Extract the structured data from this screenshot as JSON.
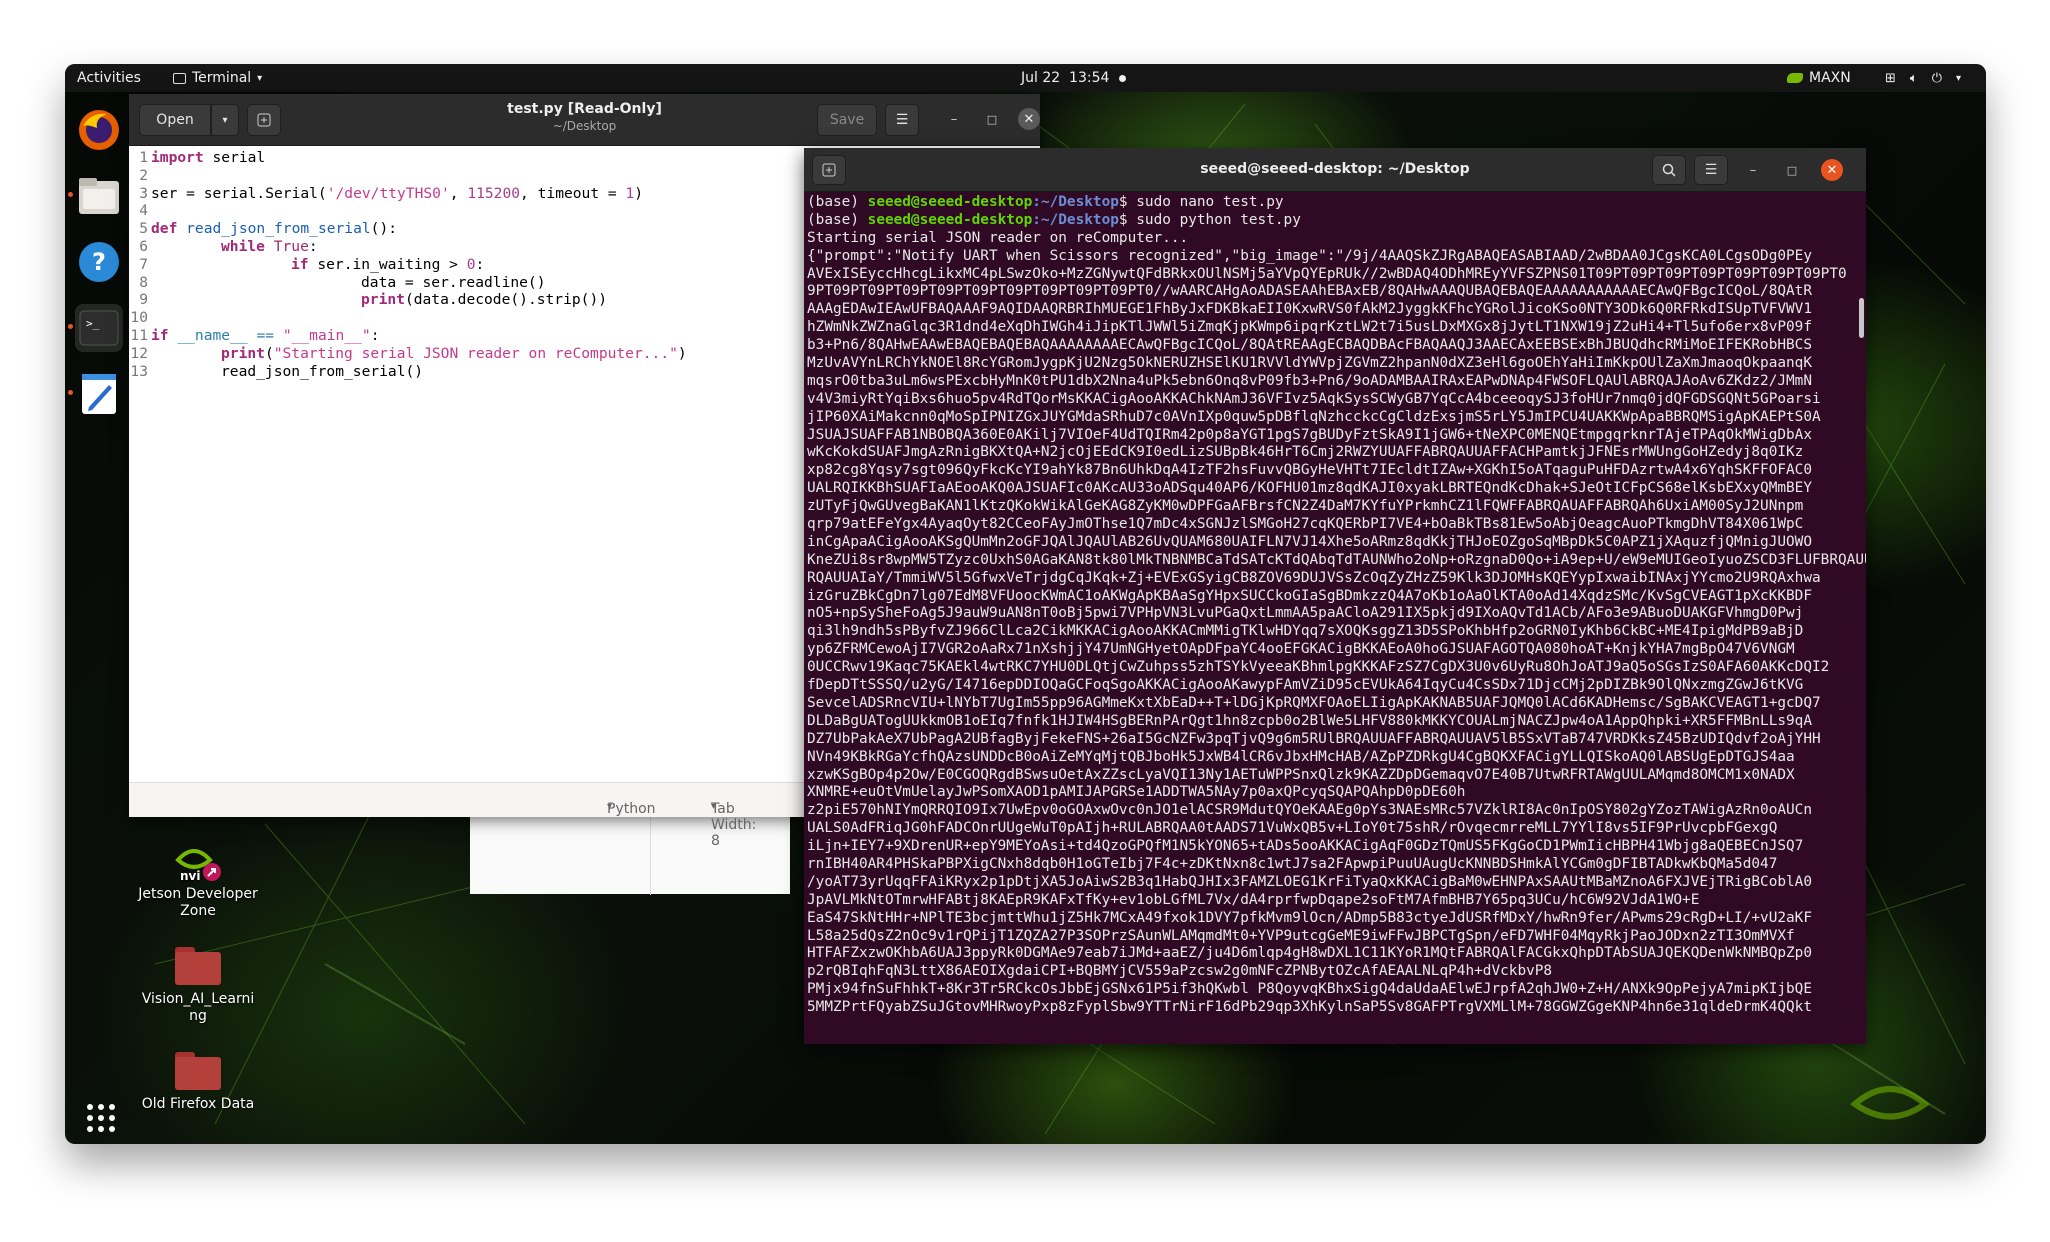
{
  "topbar": {
    "activities": "Activities",
    "app_name": "Terminal",
    "clock": "Jul 22  13:54",
    "power_mode": "MAXN"
  },
  "desktop": {
    "icons": [
      {
        "label": "Jetson Developer Zone"
      },
      {
        "label": "Vision_AI_Learning"
      },
      {
        "label": "Old Firefox Data"
      }
    ]
  },
  "editor": {
    "title": "test.py [Read-Only]",
    "subtitle": "~/Desktop",
    "open_label": "Open",
    "save_label": "Save",
    "status_language": "Python",
    "status_tab": "Tab Width: 8",
    "lines": [
      "1",
      "2",
      "3",
      "4",
      "5",
      "6",
      "7",
      "8",
      "9",
      "10",
      "11",
      "12",
      "13"
    ],
    "code": {
      "l1_kw": "import",
      "l1_rest": " serial",
      "l3_a": "ser = serial.Serial(",
      "l3_str": "'/dev/ttyTHS0'",
      "l3_b": ", ",
      "l3_num": "115200",
      "l3_c": ", timeout = ",
      "l3_num2": "1",
      "l3_d": ")",
      "l5_kw": "def",
      "l5_fn": " read_json_from_serial",
      "l5_rest": "():",
      "l6_kw": "while",
      "l6_val": " True",
      "l6_rest": ":",
      "l7_kw": "if",
      "l7_rest": " ser.in_waiting > ",
      "l7_num": "0",
      "l7_end": ":",
      "l8": "data = ser.readline()",
      "l9_fn": "print",
      "l9_rest": "(data.decode().strip())",
      "l11_kw": "if",
      "l11_a": " __name__ == ",
      "l11_str": "\"__main__\"",
      "l11_b": ":",
      "l12_fn": "print",
      "l12_a": "(",
      "l12_str": "\"Starting serial JSON reader on reComputer...\"",
      "l12_b": ")",
      "l13": "read_json_from_serial()"
    }
  },
  "terminal": {
    "title": "seeed@seeed-desktop: ~/Desktop",
    "prompts": [
      {
        "env": "(base) ",
        "user": "seeed@seeed-desktop",
        "path": ":~/Desktop",
        "cmd": "$ sudo nano test.py"
      },
      {
        "env": "(base) ",
        "user": "seeed@seeed-desktop",
        "path": ":~/Desktop",
        "cmd": "$ sudo python test.py"
      }
    ],
    "output": [
      "Starting serial JSON reader on reComputer...",
      "{\"prompt\":\"Notify UART when Scissors recognized\",\"big_image\":\"/9j/4AAQSkZJRgABAQEASABIAAD/2wBDAA0JCgsKCA0LCgsODg0PEy",
      "AVExISEyccHhcgLikxMC4pLSwzOko+MzZGNywtQFdBRkxOUlNSMj5aYVpQYEpRUk//2wBDAQ4ODhMREyYVFSZPNS01T09PT09PT09PT09PT09PT09PT09PT0",
      "9PT09PT09PT09PT09PT09PT09PT09PT09PT09PT0//wAARCAHgAoADASEAAhEBAxEB/8QAHwAAAQUBAQEBAQEAAAAAAAAAAAECAwQFBgcICQoL/8QAtR",
      "AAAgEDAwIEAwUFBAQAAAF9AQIDAAQRBRIhMUEGE1FhByJxFDKBkaEII0KxwRVS0fAkM2JyggkKFhcYGRolJicoKSo0NTY3ODk6Q0RFRkdISUpTVFVWV1",
      "hZWmNkZWZnaGlqc3R1dnd4eXqDhIWGh4iJipKTlJWWl5iZmqKjpKWmp6ipqrKztLW2t7i5usLDxMXGx8jJytLT1NXW19jZ2uHi4+Tl5ufo6erx8vP09f",
      "b3+Pn6/8QAHwEAAwEBAQEBAQEBAQAAAAAAAAECAwQFBgcICQoL/8QAtREAAgECBAQDBAcFBAQAAQJ3AAECAxEEBSExBhJBUQdhcRMiMoEIFEKRobHBCS",
      "MzUvAVYnLRChYkNOEl8RcYGRomJygpKjU2Nzg5OkNERUZHSElKU1RVVldYWVpjZGVmZ2hpanN0dXZ3eHl6goOEhYaHiImKkpOUlZaXmJmaoqOkpaanqK",
      "mqsrO0tba3uLm6wsPExcbHyMnK0tPU1dbX2Nna4uPk5ebn6Onq8vP09fb3+Pn6/9oADAMBAAIRAxEAPwDNAp4FWSOFLQAUlABRQAJAoAv6ZKdz2/JMmN",
      "v4V3miyRtYqiBxs6huo5pv4RdTQorMsKKACigAooAKKAChkNAmJ36VFIvz5AqkSysSCWyGB7YqCcA4bceeoqySJ3foHUr7nmq0jdQFGDSGQNt5GPoarsi",
      "jIP60XAiMakcnn0qMoSpIPNIZGxJUYGMdaSRhuD7c0AVnIXp0quw5pDBflqNzhcckcCgCldzExsjmS5rLY5JmIPCU4UAKKWpApaBBRQMSigApKAEPtS0A",
      "JSUAJSUAFFAB1NBOBQA360E0AKilj7VIOeF4UdTQIRm42p0p8aYGT1pgS7gBUDyFztSkA9I1jGW6+tNeXPC0MENQEtmpgqrknrTAjeTPAqOkMWigDbAx",
      "wKcKokdSUAFJmgAzRnigBKXtQA+N2jcOjEEdCK9I0edLizSUBpBk46HrT6Cmj2RWZYUUAFFABRQAUUAFFACHPamtkjJFNEsrMWUngGoHZedyj8q0IKz",
      "xp82cg8Yqsy7sgt096QyFkcKcYI9ahYk87Bn6UhkDqA4IzTF2hsFuvvQBGyHeVHTt7IEcldtIZAw+XGKhI5oATqaguPuHFDAzrtwA4x6YqhSKFFOFAC0",
      "UALRQIKKBhSUAFIaAEooAKQ0AJSUAFIc0AKcAU33oADSqu40AP6/KOFHU01mz8qdKAJI0xyakLBRTEQndKcDhak+SJeOtICFpCS68elKsbEXxyQMmBEY",
      "zUTyFjQwGUvegBaKAN1lKtzQKokWikAlGeKAG8ZyKM0wDPFGaAFBrsfCN2Z4DaM7KYfuYPrkmhCZ1lFQWFFABRQAUAFFABRQAh6UxiAM00SyJ2UNnpm",
      "qrp79atEFeYgx4AyaqOyt82CCeoFAyJmOThse1Q7mDc4xSGNJzlSMGoH27cqKQERbPI7VE4+bOaBkTBs81Ew5oAbjOeagcAuoPTkmgDhVT84X061WpC",
      "inCgApaACigAooAKSgQUmMn2oGFJQAlJQAUlAB26UvQUAM680UAIFLN7VJ14Xhe5oARmz8qdKkjTHJoEOZgoSqMBpDk5C0APZ1jXAquzfjQMnigJUOWO",
      "KneZUi8sr8wpMW5TZyzc0UxhS0AGaKAN8tk80lMkTNBNMBCaTdSATcKTdQAbqTdTAUNWho2oNp+oRzgnaD0Qo+iA9ep+U/eW9eMUIGeoIyuoZSCD3FLUFBRQAUUAFAB",
      "RQAUUAIaY/TmmiWV5l5GfwxVeTrjdgCqJKqk+Zj+EVExGSyigCB8ZOV69DUJVSsZcOqZyZHzZ59Klk3DJOMHsKQEYypIxwaibINAxjYYcmo2U9RQAxhwa",
      "izGruZBkCgDn7lg07EdM8VFUoocKWmAC1oAKWgApKBAaSgYHpxSUCCkoGIaSgBDmkzzQ4A7oKb1oAaOlKTA0oAd14XqdzSMc/KvSgCVEAGT1pXcKKBDF",
      "nO5+npSySheFoAg5J9auW9uAN8nT0oBj5pwi7VPHpVN3LvuPGaQxtLmmAA5paACloA291IX5pkjd9IXoAQvTd1ACb/AFo3e9ABuoDUAKGFVhmgD0Pwj",
      "qi3lh9ndh5sPByfvZJ966ClLca2CikMKKACigAooAKKACmMMigTKlwHDYqq7sXOQKsggZ13D5SPoKhbHfp2oGRN0IyKhb6CkBC+ME4IpigMdPB9aBjD",
      "yp6ZFRMCewoAjI7VGR2oAaRx71nXshjjY47UmNGHyetOApDFpaYC4ooEFGKACigBKKAEoA0hoGJSUAFAGOTQA080hoAT+KnjkYHA7mgBpO47V6VNGM",
      "0UCCRwv19Kaqc75KAEkl4wtRKC7YHU0DLQtjCwZuhpss5zhTSYkVyeeaKBhmlpgKKKAFzSZ7CgDX3U0v6UyRu8OhJoATJ9aQ5oSGsIzS0AFA60AKKcDQI2",
      "fDepDTtSSSQ/u2yG/I4716epDDIOQaGCFoqSgoAKKACigAooAKawypFAmVZiD95cEVUkA64IqyCu4CsSDx71DjcCMj2pDIZBk9OlQNxzmgZGwJ6tKVG",
      "SevcelADSRncVIU+lNYbT7UgIm55pp96AGMmeKxtXbEaD++T+lDGjKpRQMXFOAoELIigApKAKNAB5UAFJQMQ0lACd6KADHemsc/SgBAKCVEAGT1+gcDQ7",
      "DLDaBgUATogUUkkmOB1oEIq7fnfk1HJIW4HSgBERnPArQgt1hn8zcpb0o2BlWe5LHFV880kMKKYCOUALmjNACZJpw4oA1AppQhpki+XR5FFMBnLLs9qA",
      "DZ7UbPakAeX7UbPagA2UBfagByjFekeFNS+26aI5GcNZFw3pqTjvQ9g6m5RUlBRQAUUAFFABRQAUUAV5lB5SxVTaB747VRDKksZ45BzUDIQdvf2oAjYHH",
      "NVn49KBkRGaYcfhQAzsUNDDcB0oAiZeMYqMjtQBJboHk5JxWB4lCR6vJbxHMcHAB/AZpPZDRkgU4CgBQKXFACigYLLQISkoAQ0lABSUgEpDTGJS4aa",
      "xzwKSgBOp4p2Ow/E0CGOQRgdBSwsuOetAxZZscLyaVQI13Ny1AETuWPPSnxQlzk9KAZZDpDGemaqvO7E40B7UtwRFRTAWgUULAMqmd8OMCM1x0NADX",
      "XNMRE+euOtVmUelayJwPSomXAOD1pAMIJAPGRSe1ADDTWA5NAy7p0axQPcyqSQAPQAhpD0pDE60h",
      "z2piE570hNIYmQRRQIO9Ix7UwEpv0oGOAxwOvc0nJO1elACSR9MdutQYOeKAAEg0pYs3NAEsMRc57VZklRI8Ac0nIpOSY802gYZozTAWigAzRn0oAUCn",
      "UALS0AdFRiqJG0hFADCOnrUUgeWuT0pAIjh+RULABRQAA0tAADS71VuWxQB5v+LIoY0t75shR/rOvqecmrreMLL7YYlI8vs5IF9PrUvcpbFGexgQ",
      "iLjn+IEY7+9XDrenUR+epY9MEYoAsi+td4QzoGPQfM1N5kYON65+tADs5ooAKKACigAqF0GDzTQmUS5FKgGoCD1PWmIicHBPH41Wbjg8aQEBECnJSQ7",
      "rnIBH40AR4PHSkaPBPXigCNxh8dqb0H1oGTeIbj7F4c+zDKtNxn8c1wtJ7sa2FApwpiPuuUAugUcKNNBDSHmkAlYCGm0gDFIBTADkwKbQMa5d047",
      "/yoAT73yrUqqFFAiKRyx2p1pDtjXA5JoAiwS2B3q1HabQJHIx3FAMZLOEG1KrFiTyaQxKKACigBaM0wEHNPAxSAAUtMBaMZnoA6FXJVEjTRigBCoblA0",
      "JpAVLMkNtOTmrwHFABtj8KAEpR9KAFxTfKy+ev1obLGfML7Vx/dA4rprfwpDqape2soFtM7AfmBHB7Y65pq3UCu/hC6W92VJdA1WO+E",
      "EaS47SkNtHHr+NPlTE3bcjmttWhu1jZ5Hk7MCxA49fxok1DVY7pfkMvm9lOcn/ADmp5B83ctyeJdUSRfMDxY/hwRn9fer/APwms29cRgD+LI/+vU2aKF",
      "L58a25dQsZ2nOc9v1rQPijT1ZQZA27P3SOPrzSAunWLAMqmdMt0+YVP9utcgGeME9iwFFwJBPCTgSpn/eFD7WHF04MqyRkjPaoJODxn2zTI3OmMVXf",
      "HTFAFZxzwOKhbA6UAJ3ppyRk0DGMAe97eab7iJMd+aaEZ/ju4D6mlqp4gH8wDXL1C11KYoR1MQtFABRQAlFACGkxQhpDTAbSUAJQEKQDenWkNMBQpZp0",
      "p2rQBIqhFqN3LttX86AEOIXgdaiCPI+BQBMYjCV559aPzcsw2g0mNFcZPNBytOZcAfAEAALNLqP4h+dVckbvP8",
      "PMjx94fnSuFhhkT+8Kr3Tr5RCkcOsJbbEjGSNx61P5if3hQKwbl P8QoyvqKBhxSigQ4daUdaAElwEJrpfA2qhJW0+Z+H/ANXk9OpPejyA7mipKIjbQE",
      "5MMZPrtFQyabZSuJGtovMHRwoyPxp8zFyplSbw9YTTrNirF16dPb29qp3XhKylnSaP5Sv8GAFPTrgVXMLlM+78GGWZGgeKNP4hn6e31qldeDrmK4QQkt"
    ]
  }
}
